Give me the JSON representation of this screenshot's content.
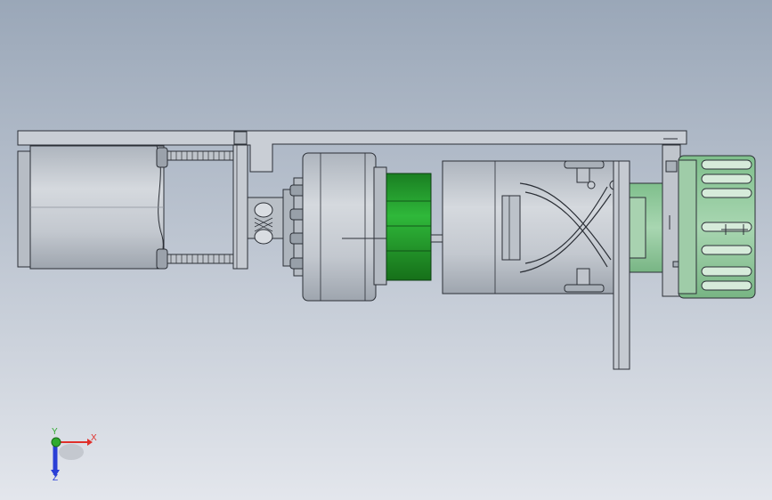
{
  "viewport": {
    "background_top": "#9aa7b8",
    "background_bottom": "#e3e6ec"
  },
  "colors": {
    "body": "#c7ccd3",
    "body_dark": "#a9b0b9",
    "outline": "#2b2f36",
    "green": "#1f9a2a",
    "green_light": "#8fc99a",
    "green_pale": "#b9dcc0"
  },
  "triad": {
    "x_label": "X",
    "y_label": "Y",
    "z_label": "Z",
    "x_color": "#e0302b",
    "y_color": "#2faa2f",
    "z_color": "#2a3fd6"
  }
}
